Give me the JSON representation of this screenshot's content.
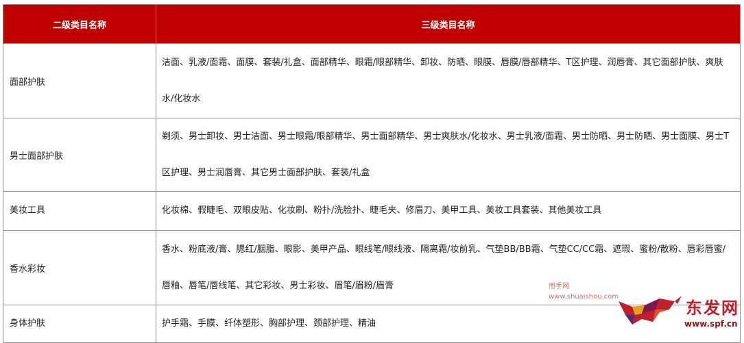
{
  "table": {
    "headers": [
      "二级类目名称",
      "三级类目名称"
    ],
    "rows": [
      {
        "category": "面部护肤",
        "subcategories": "洁面、乳液/面霜、面膜、套装/礼盒、面部精华、眼霜/眼部精华、卸妆、防晒、眼膜、唇膜/唇部精华、T区护理、润唇膏、其它面部护肤、爽肤水/化妆水"
      },
      {
        "category": "男士面部护肤",
        "subcategories": "剃须、男士卸妆、男士洁面、男士眼霜/眼部精华、男士面部精华、男士爽肤水/化妆水、男士乳液/面霜、男士防晒、男士防晒、男士面膜、男士T区护理、男士润唇膏、其它男士面部护肤、套装/礼盒"
      },
      {
        "category": "美妆工具",
        "subcategories": "化妆棉、假睫毛、双眼皮贴、化妆刷、粉扑/洗脸扑、睫毛夹、修眉刀、美甲工具、美妆工具套装、其他美妆工具"
      },
      {
        "category": "香水彩妆",
        "subcategories": "香水、粉底液/膏、腮红/胭脂、眼影、美甲产品、眼线笔/眼线液、隔离霜/妆前乳、气垫BB/BB霜、气垫CC/CC霜、遮瑕、蜜粉/散粉、唇彩唇蜜/唇釉、唇笔/唇线笔、其它彩妆、男士彩妆、眉笔/眉粉/眉膏"
      },
      {
        "category": "身体护肤",
        "subcategories": "护手霜、手膜、纤体塑形、胸部护理、颈部护理、精油"
      }
    ]
  },
  "watermark": {
    "line1": "甩手网",
    "line2": "www.shuaishou.com"
  },
  "logo": {
    "text": "东发网",
    "url": "www.spf.cn"
  },
  "colors": {
    "header_bg": "#c00000",
    "border": "#8c8c8c"
  }
}
